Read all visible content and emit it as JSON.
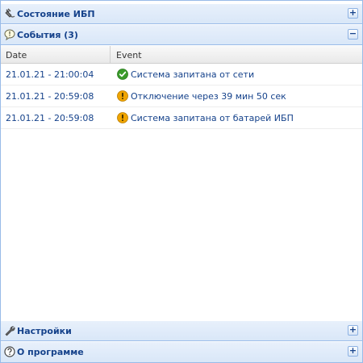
{
  "panels": {
    "ups_state": {
      "title": "Состояние ИБП",
      "tool": "+"
    },
    "events": {
      "title": "События (3)",
      "tool": "−"
    },
    "settings": {
      "title": "Настройки",
      "tool": "+"
    },
    "about": {
      "title": "О программе",
      "tool": "+"
    }
  },
  "grid": {
    "columns": [
      "Date",
      "Event"
    ],
    "rows": [
      {
        "date": "21.01.21 - 21:00:04",
        "event": "Система запитана от сети",
        "icon": "ok-icon"
      },
      {
        "date": "21.01.21 - 20:59:08",
        "event": "Отключение через 39 мин 50 сек",
        "icon": "warning-icon"
      },
      {
        "date": "21.01.21 - 20:59:08",
        "event": "Система запитана от батарей ИБП",
        "icon": "warning-icon"
      }
    ]
  },
  "colors": {
    "header_text": "#15428b",
    "border": "#99bbe8",
    "ok": "#3a9a2a",
    "warn": "#f0a500"
  }
}
